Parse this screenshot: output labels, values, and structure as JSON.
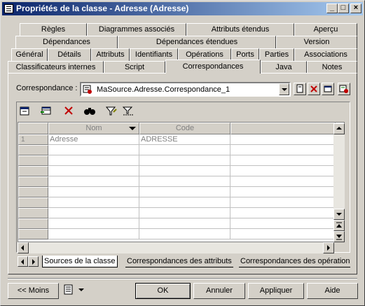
{
  "window": {
    "title": "Propriétés de la classe - Adresse (Adresse)",
    "min_glyph": "_",
    "max_glyph": "□",
    "close_glyph": "×"
  },
  "tabs": {
    "row1": [
      "Règles",
      "Diagrammes associés",
      "Attributs étendus",
      "Aperçu"
    ],
    "row2": [
      "Dépendances",
      "Dépendances étendues",
      "Version"
    ],
    "row3": [
      "Général",
      "Détails",
      "Attributs",
      "Identifiants",
      "Opérations",
      "Ports",
      "Parties",
      "Associations"
    ],
    "row4": [
      "Classificateurs internes",
      "Script",
      "Correspondances",
      "Java",
      "Notes"
    ],
    "active": "Correspondances"
  },
  "mapping": {
    "label": "Correspondance :",
    "selected": "MaSource.Adresse.Correspondance_1"
  },
  "grid": {
    "columns": [
      "Nom",
      "Code"
    ],
    "rows": [
      {
        "num": "1",
        "nom": "Adresse",
        "code": "ADRESSE"
      }
    ]
  },
  "bottom_tabs": [
    "Sources de la classe",
    "Correspondances des attributs",
    "Correspondances des opération"
  ],
  "buttons": {
    "less": "<< Moins",
    "ok": "OK",
    "cancel": "Annuler",
    "apply": "Appliquer",
    "help": "Aide"
  },
  "colors": {
    "title_start": "#0a246a",
    "title_end": "#a6caf0",
    "face": "#d4d0c8",
    "delete_red": "#c00000"
  }
}
